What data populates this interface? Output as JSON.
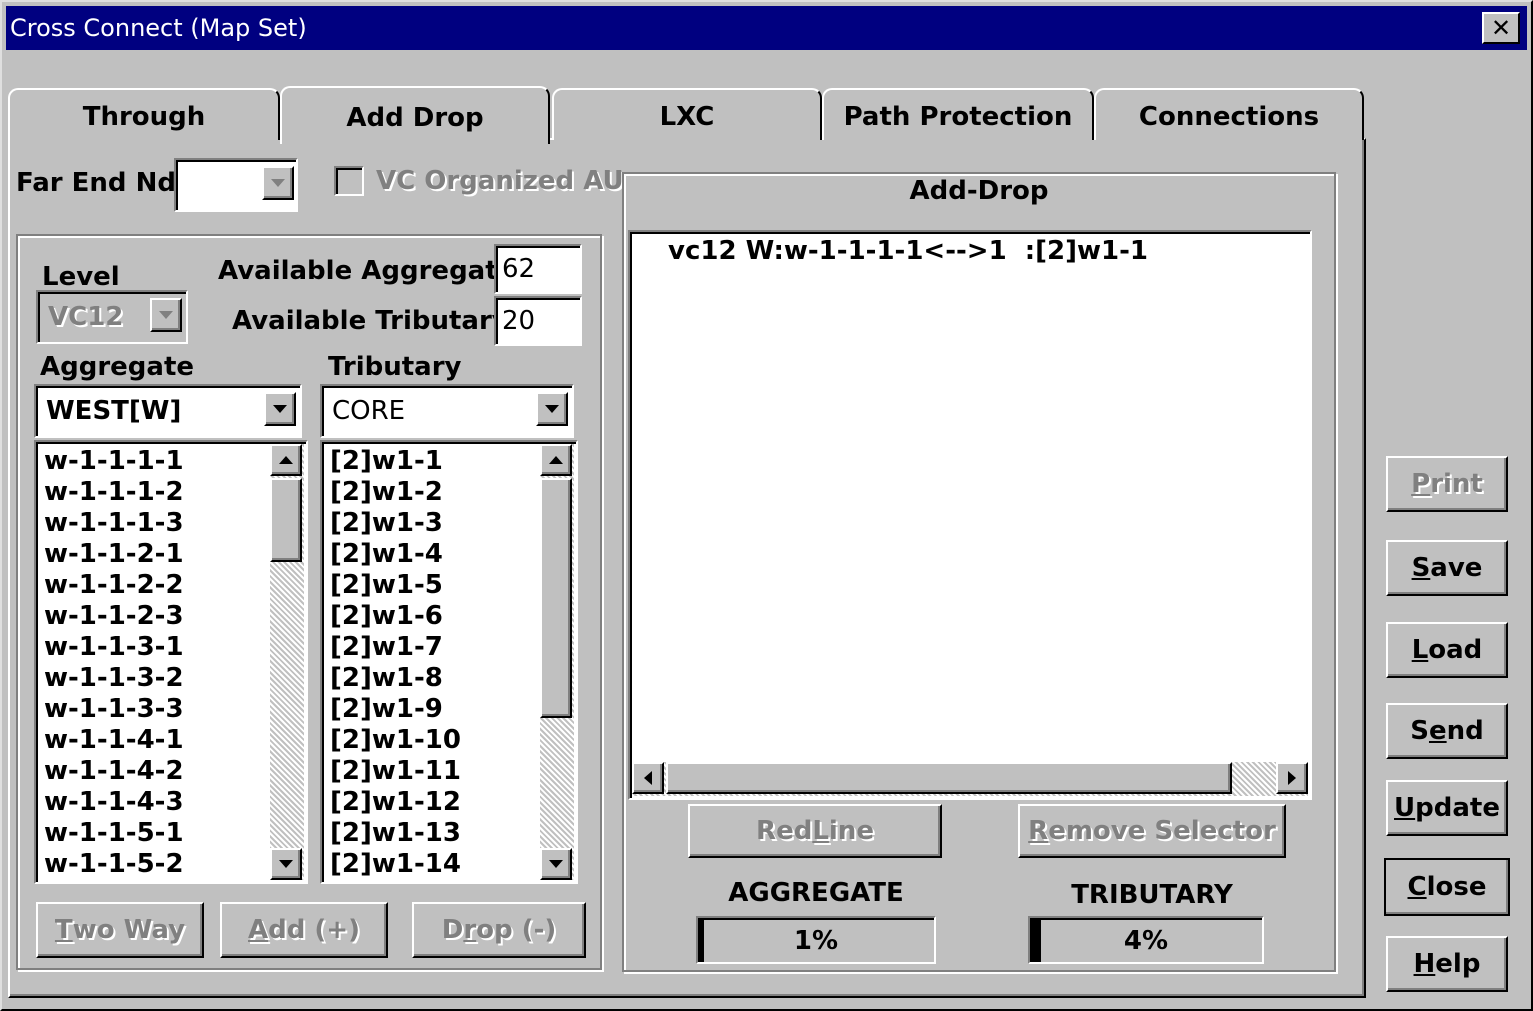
{
  "window": {
    "title": "Cross Connect (Map Set)",
    "close_glyph": "✕"
  },
  "tabs": [
    {
      "label": "Through",
      "active": false
    },
    {
      "label": "Add Drop",
      "active": true
    },
    {
      "label": "LXC",
      "active": false
    },
    {
      "label": "Path Protection",
      "active": false
    },
    {
      "label": "Connections",
      "active": false
    }
  ],
  "far_end": {
    "label": "Far End Nd",
    "value": ""
  },
  "vc_organized": {
    "label": "VC Organized AU",
    "checked": false,
    "enabled": false
  },
  "level": {
    "label": "Level",
    "value": "VC12",
    "enabled": false
  },
  "available": {
    "aggregate_label": "Available Aggregate",
    "aggregate_value": "62",
    "tributary_label": "Available Tributary",
    "tributary_value": "20"
  },
  "aggregate": {
    "label": "Aggregate",
    "selected": "WEST[W]",
    "items": [
      "w-1-1-1-1",
      "w-1-1-1-2",
      "w-1-1-1-3",
      "w-1-1-2-1",
      "w-1-1-2-2",
      "w-1-1-2-3",
      "w-1-1-3-1",
      "w-1-1-3-2",
      "w-1-1-3-3",
      "w-1-1-4-1",
      "w-1-1-4-2",
      "w-1-1-4-3",
      "w-1-1-5-1",
      "w-1-1-5-2"
    ]
  },
  "tributary": {
    "label": "Tributary",
    "selected": "CORE",
    "items": [
      "[2]w1-1",
      "[2]w1-2",
      "[2]w1-3",
      "[2]w1-4",
      "[2]w1-5",
      "[2]w1-6",
      "[2]w1-7",
      "[2]w1-8",
      "[2]w1-9",
      "[2]w1-10",
      "[2]w1-11",
      "[2]w1-12",
      "[2]w1-13",
      "[2]w1-14"
    ]
  },
  "action_buttons": {
    "two_way": {
      "prefix": "",
      "accel": "T",
      "rest": "wo Way"
    },
    "add": {
      "prefix": "",
      "accel": "A",
      "rest": "dd (+)"
    },
    "drop": {
      "prefix": "D",
      "accel": "r",
      "rest": "op (-)"
    }
  },
  "add_drop_panel": {
    "title": "Add-Drop",
    "entries": [
      "vc12 W:w-1-1-1-1<-->1  :[2]w1-1"
    ],
    "red_line": {
      "prefix": "Red ",
      "accel": "L",
      "rest": "ine"
    },
    "remove_selector": {
      "prefix": "",
      "accel": "R",
      "rest": "emove Selector"
    },
    "aggregate_label": "AGGREGATE",
    "aggregate_value": "1%",
    "aggregate_fraction": 0.01,
    "tributary_label": "TRIBUTARY",
    "tributary_value": "4%",
    "tributary_fraction": 0.04
  },
  "side_buttons": {
    "print": {
      "prefix": "",
      "accel": "P",
      "rest": "rint",
      "enabled": false
    },
    "save": {
      "prefix": "",
      "accel": "S",
      "rest": "ave",
      "enabled": true
    },
    "load": {
      "prefix": "",
      "accel": "L",
      "rest": "oad",
      "enabled": true
    },
    "send": {
      "prefix": "S",
      "accel": "e",
      "rest": "nd",
      "enabled": true
    },
    "update": {
      "prefix": "",
      "accel": "U",
      "rest": "pdate",
      "enabled": true
    },
    "close": {
      "prefix": "",
      "accel": "C",
      "rest": "lose",
      "enabled": true
    },
    "help": {
      "prefix": "",
      "accel": "H",
      "rest": "elp",
      "enabled": true
    }
  },
  "colors": {
    "titlebar": "#000080",
    "face": "#c0c0c0",
    "window": "#ffffff",
    "disabled_text": "#808080"
  }
}
